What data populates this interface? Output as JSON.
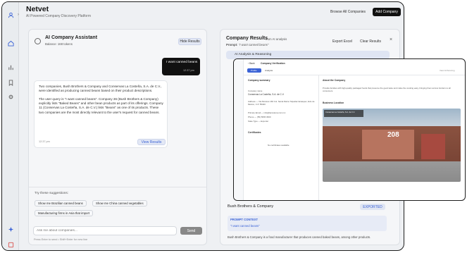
{
  "app": {
    "name": "Netvet",
    "tagline": "AI Powered Company Discovery Platform"
  },
  "header": {
    "browse": "Browse All Companies",
    "add": "Add Company"
  },
  "assistant": {
    "title": "AI Company Assistant",
    "balance": "Balance: 168 tokens",
    "hide_results": "Hide Results",
    "user_msg": "I want canned beans",
    "user_time": "12:37 pm",
    "reply": "Two companies, Bush Brothers & Company and Conservas La Costeña, S.A. de C.V., were identified as producing canned beans based on their product descriptions.\n\nThe user query is \"I want canned beans\". Company 36 (Bush Brothers & Company) explicitly lists \"Baked Beans\" and other bean products as part of its offerings. Company 11 (Conservas La Costeña, S.A. de C.V.) lists \"Beans\" as one of its products. These two companies are the most directly relevant to the user's request for canned beans.",
    "reply_time": "12:37 pm",
    "view_results": "View Results",
    "suggest_label": "Try these suggestions:",
    "suggestions": [
      "Show me Brazilian canned beans",
      "Show me China canned vegetables",
      "Manufacturing firms in Asia that import"
    ],
    "input_placeholder": "Ask me about companies...",
    "send": "Send",
    "hint": "Press Enter to send • Shift+Enter for new line"
  },
  "results": {
    "title": "Company Results",
    "from": "from AI analysis",
    "prompt_label": "Prompt:",
    "prompt": "\"I want canned beans\"",
    "export": "Export Excel",
    "clear": "Clear Results",
    "analysis": "AI Analysis & Reasoning",
    "card_name": "Bush Brothers & Company",
    "exported": "EXPORTED",
    "prompt_ctx": "PROMPT CONTEXT",
    "prompt_ctx_val": "\"I want canned beans\"",
    "desc": "Bush Brothers & Company is a food manufacturer that produces canned baked beans, among other products."
  },
  "verify": {
    "back": "Back",
    "title": "Company Verification",
    "tab_profile": "Profile",
    "tab_analysis": "Analysis",
    "view_link": "View forthcoming",
    "summary_title": "Company summary",
    "name_label": "Company name",
    "name_value": "Conservas La Costeña, S.A. de C.V.",
    "rows": [
      [
        "Address",
        "Via Morelos 166 Col. Santa María Tulpetlac Ecatepec, Edo de México, C.P. 55400"
      ],
      [
        "Primary Email",
        "info@lacostena.com.mx"
      ],
      [
        "Phone",
        "(55) 5836 3600"
      ],
      [
        "State Type",
        "Exporter"
      ]
    ],
    "certs_title": "Certificates",
    "certs_empty": "No certificates available",
    "about_title": "About the Company",
    "about_text": "Provide families with high-quality packaged foods that preserve the good taste and make the cooking easy, bringing them across borders to all consumers.",
    "location_title": "Business Location",
    "map_caption": "Conservas La Costeña, S.A. de C.V.",
    "building_number": "208"
  },
  "colors": {
    "accent": "#3b63d6",
    "dark": "#111111"
  }
}
